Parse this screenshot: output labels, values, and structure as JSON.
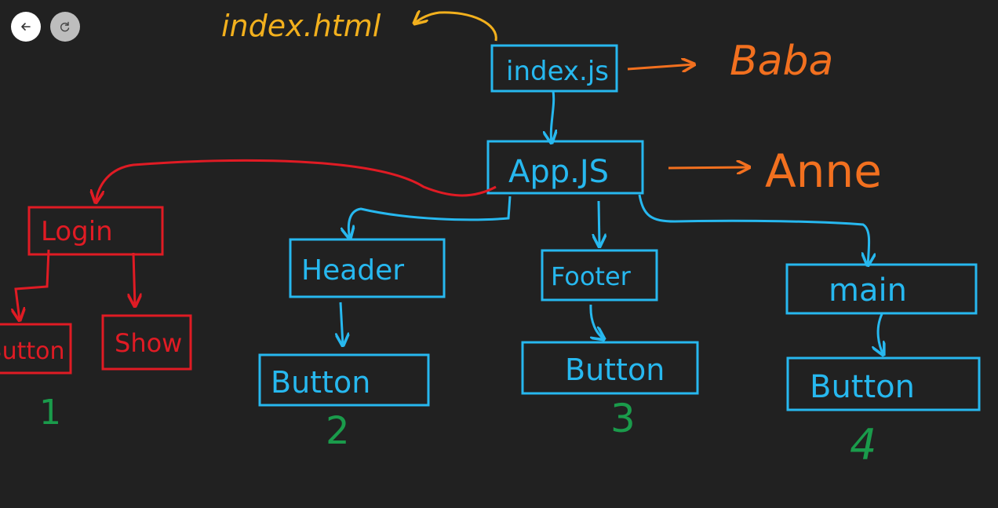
{
  "toolbar": {
    "back_icon": "arrow-left-icon",
    "redo_icon": "redo-icon"
  },
  "colors": {
    "background": "#212121",
    "blue": "#27b8ef",
    "red": "#e01b24",
    "orange": "#f2701f",
    "yellow": "#f2b01d",
    "green": "#1a9b4b"
  },
  "nodes": {
    "index_html": "index.html",
    "index_js": "index.js",
    "app_js": "App.JS",
    "login": "Login",
    "header": "Header",
    "footer": "Footer",
    "main": "main",
    "login_button": "Button",
    "show": "Show",
    "header_button": "Button",
    "footer_button": "Button",
    "main_button": "Button"
  },
  "annotations": {
    "baba": "Baba",
    "anne": "Anne",
    "num1": "1",
    "num2": "2",
    "num3": "3",
    "num4": "4"
  }
}
